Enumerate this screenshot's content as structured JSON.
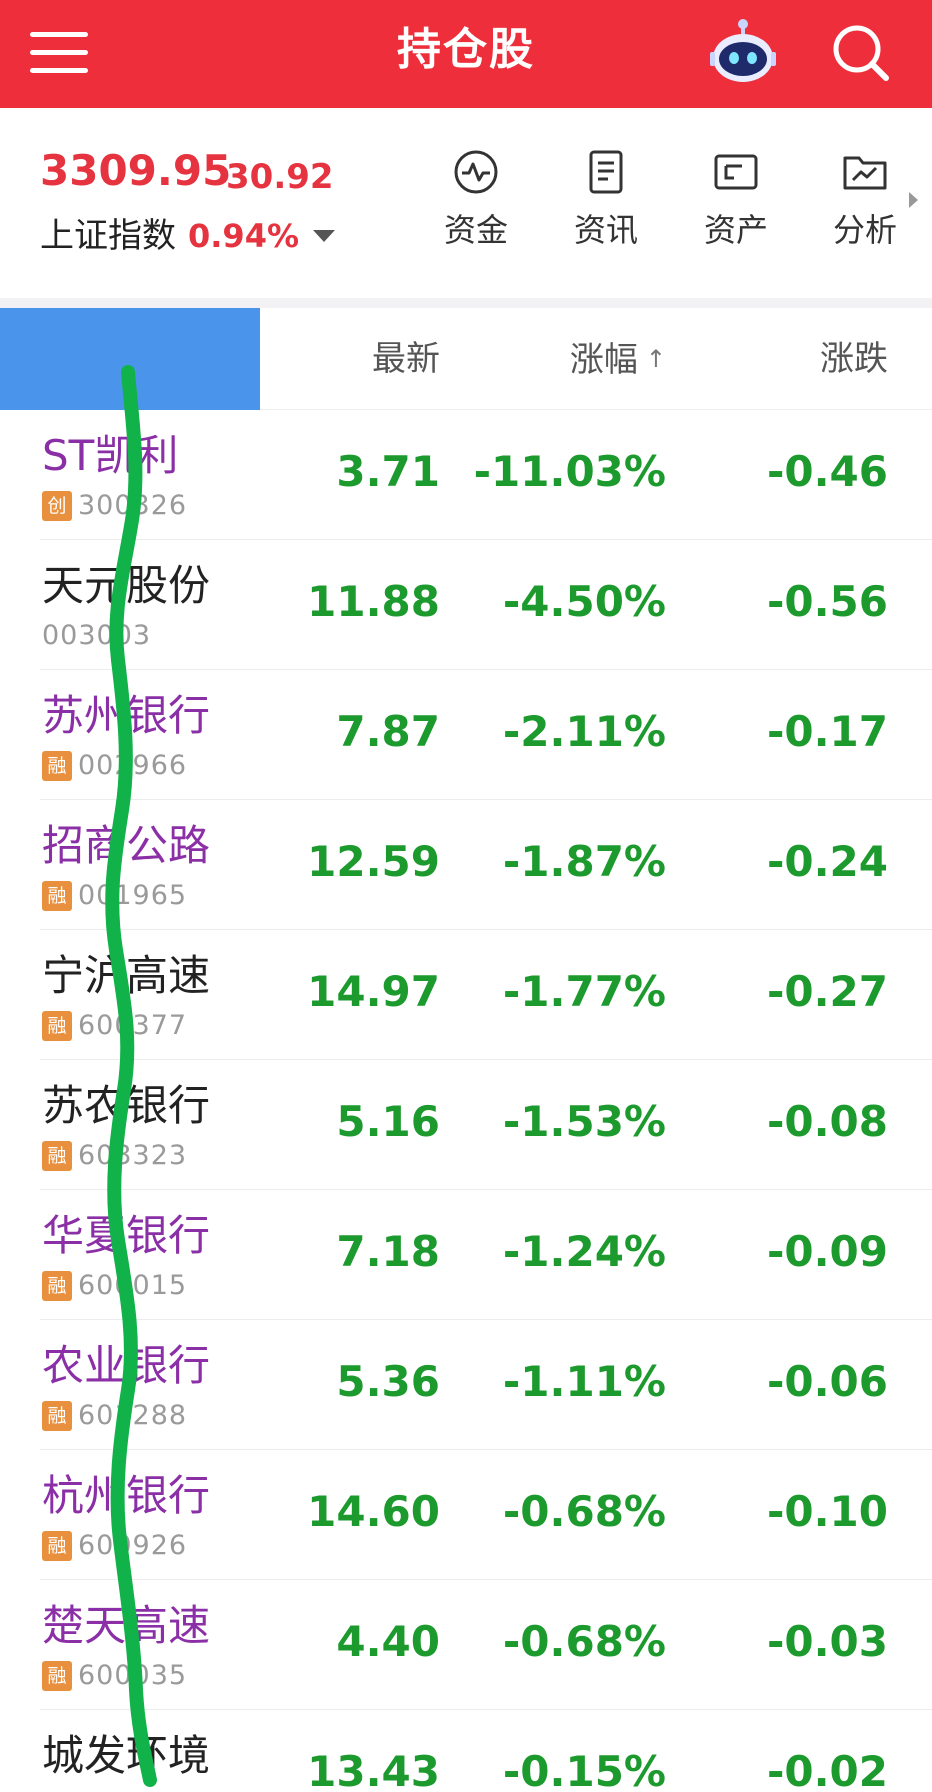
{
  "header": {
    "title": "持仓股",
    "menu_icon": "menu-icon",
    "assistant_icon": "robot-icon",
    "search_icon": "search-icon",
    "background_color": "#ee2f3b"
  },
  "index": {
    "value": "3309.95",
    "change": "30.92",
    "name": "上证指数",
    "percent": "0.94%",
    "color": "#e53340"
  },
  "shortcuts": [
    {
      "label": "资金",
      "icon": "pulse-icon"
    },
    {
      "label": "资讯",
      "icon": "document-icon"
    },
    {
      "label": "资产",
      "icon": "wallet-icon"
    },
    {
      "label": "分析",
      "icon": "folder-chart-icon"
    }
  ],
  "columns": {
    "name": "",
    "latest": "最新",
    "pct": "涨幅",
    "pct_sort": "↑",
    "change": "涨跌"
  },
  "colors": {
    "down": "#1c9a2d",
    "name_margin": "#8b2fa6",
    "badge": "#e8903e",
    "name_column_header": "#4a94ec"
  },
  "stocks": [
    {
      "name": "ST凯利",
      "badge": "创",
      "code": "300326",
      "latest": "3.71",
      "pct": "-11.03%",
      "change": "-0.46",
      "name_style": "purple"
    },
    {
      "name": "天元股份",
      "badge": "",
      "code": "003003",
      "latest": "11.88",
      "pct": "-4.50%",
      "change": "-0.56",
      "name_style": "black"
    },
    {
      "name": "苏州银行",
      "badge": "融",
      "code": "002966",
      "latest": "7.87",
      "pct": "-2.11%",
      "change": "-0.17",
      "name_style": "purple"
    },
    {
      "name": "招商公路",
      "badge": "融",
      "code": "001965",
      "latest": "12.59",
      "pct": "-1.87%",
      "change": "-0.24",
      "name_style": "purple"
    },
    {
      "name": "宁沪高速",
      "badge": "融",
      "code": "600377",
      "latest": "14.97",
      "pct": "-1.77%",
      "change": "-0.27",
      "name_style": "black"
    },
    {
      "name": "苏农银行",
      "badge": "融",
      "code": "603323",
      "latest": "5.16",
      "pct": "-1.53%",
      "change": "-0.08",
      "name_style": "black"
    },
    {
      "name": "华夏银行",
      "badge": "融",
      "code": "600015",
      "latest": "7.18",
      "pct": "-1.24%",
      "change": "-0.09",
      "name_style": "purple"
    },
    {
      "name": "农业银行",
      "badge": "融",
      "code": "601288",
      "latest": "5.36",
      "pct": "-1.11%",
      "change": "-0.06",
      "name_style": "purple"
    },
    {
      "name": "杭州银行",
      "badge": "融",
      "code": "600926",
      "latest": "14.60",
      "pct": "-0.68%",
      "change": "-0.10",
      "name_style": "purple"
    },
    {
      "name": "楚天高速",
      "badge": "融",
      "code": "600035",
      "latest": "4.40",
      "pct": "-0.68%",
      "change": "-0.03",
      "name_style": "purple"
    },
    {
      "name": "城发环境",
      "badge": "",
      "code": "",
      "latest": "13.43",
      "pct": "-0.15%",
      "change": "-0.02",
      "name_style": "black"
    }
  ]
}
